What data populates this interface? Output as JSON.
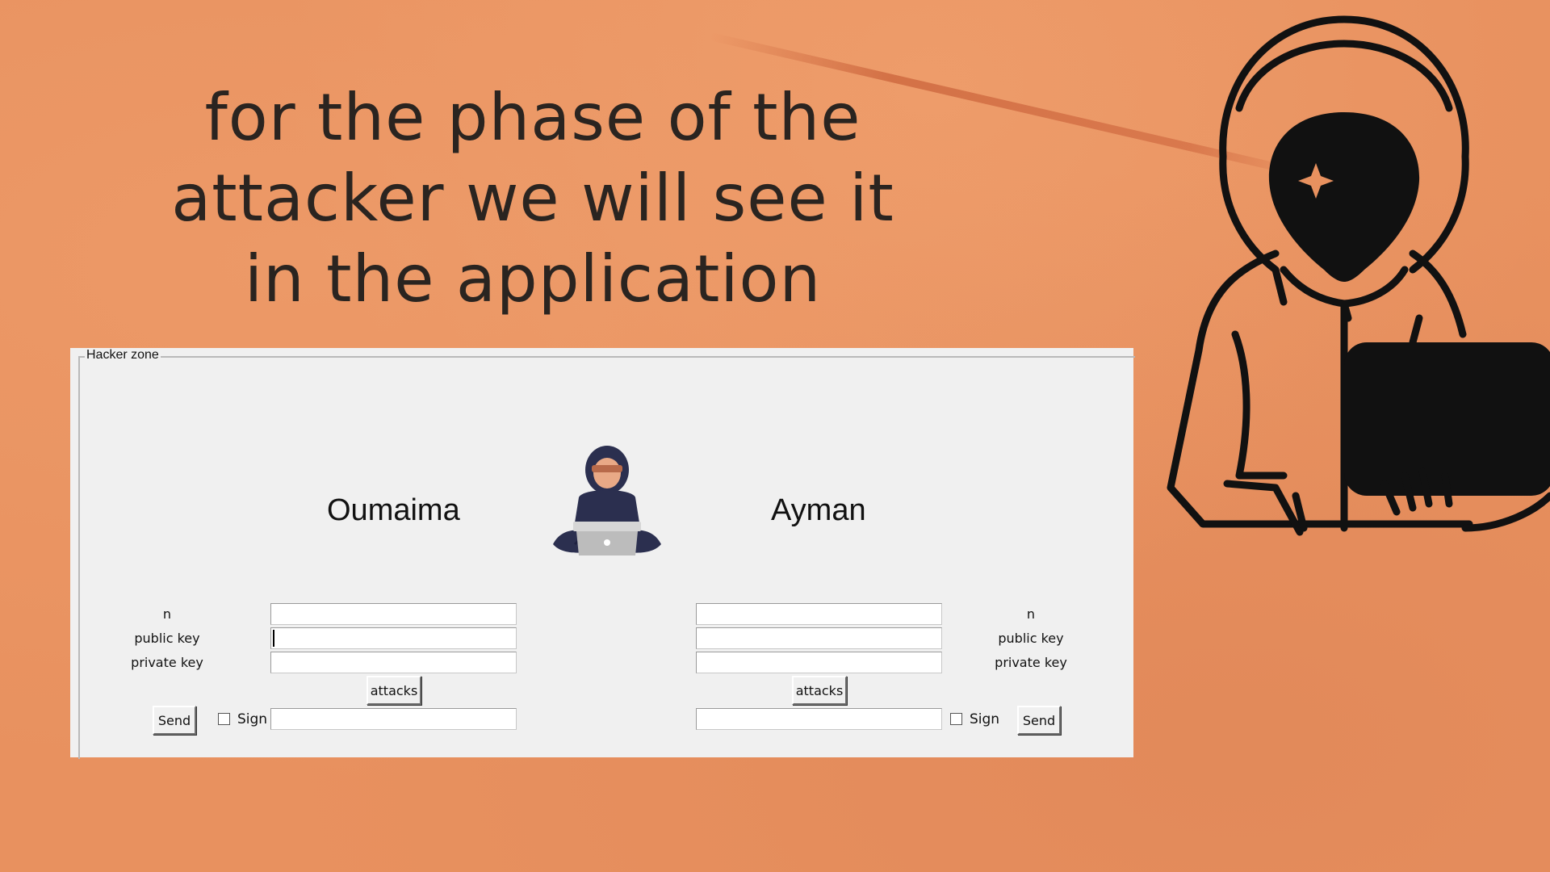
{
  "slide": {
    "headline": [
      "for the phase of the",
      "attacker we will see it",
      "in the application"
    ]
  },
  "app": {
    "frame_title": "Hacker zone",
    "left_user": {
      "name": "Oumaima",
      "labels": {
        "n": "n",
        "public_key": "public key",
        "private_key": "private key"
      },
      "values": {
        "n": "",
        "public_key": "",
        "private_key": "",
        "message": ""
      },
      "attacks_label": "attacks",
      "send_label": "Send",
      "sign_label": "Sign",
      "sign_checked": false
    },
    "right_user": {
      "name": "Ayman",
      "labels": {
        "n": "n",
        "public_key": "public key",
        "private_key": "private key"
      },
      "values": {
        "n": "",
        "public_key": "",
        "private_key": "",
        "message": ""
      },
      "attacks_label": "attacks",
      "send_label": "Send",
      "sign_label": "Sign",
      "sign_checked": false
    }
  },
  "icons": {
    "large": "hooded-hacker-laptop-icon",
    "small": "hacker-sitting-laptop-icon"
  }
}
